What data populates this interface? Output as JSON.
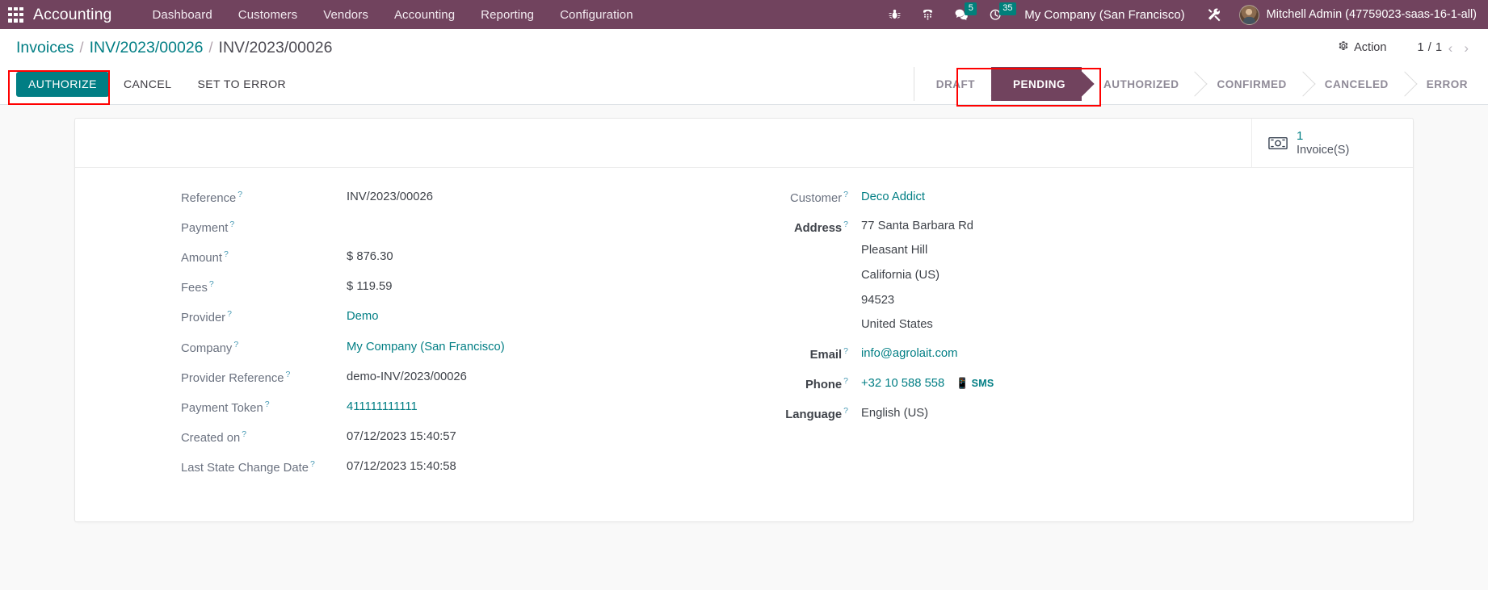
{
  "navbar": {
    "apps_icon": "apps-grid-icon",
    "brand": "Accounting",
    "menu": [
      {
        "label": "Dashboard"
      },
      {
        "label": "Customers"
      },
      {
        "label": "Vendors"
      },
      {
        "label": "Accounting"
      },
      {
        "label": "Reporting"
      },
      {
        "label": "Configuration"
      }
    ],
    "systray": [
      {
        "icon": "bug-icon",
        "badge": null
      },
      {
        "icon": "phone-dialpad-icon",
        "badge": null
      },
      {
        "icon": "messages-icon",
        "badge": "5"
      },
      {
        "icon": "clock-activities-icon",
        "badge": "35"
      }
    ],
    "company": "My Company (San Francisco)",
    "tools_icon": "wrench-screwdriver-icon",
    "avatar_icon": "user-avatar",
    "user": "Mitchell Admin (47759023-saas-16-1-all)"
  },
  "control_panel": {
    "breadcrumb": [
      {
        "label": "Invoices",
        "current": false
      },
      {
        "label": "INV/2023/00026",
        "current": false
      },
      {
        "label": "INV/2023/00026",
        "current": true
      }
    ],
    "separator": "/",
    "action_label": "Action",
    "action_icon": "gear-icon",
    "pager_value": "1 / 1",
    "pager_prev_icon": "chevron-left-icon",
    "pager_next_icon": "chevron-right-icon"
  },
  "statusbar": {
    "buttons": [
      {
        "label": "Authorize",
        "style": "primary",
        "highlighted": true
      },
      {
        "label": "Cancel",
        "style": "link",
        "highlighted": false
      },
      {
        "label": "Set to Error",
        "style": "link",
        "highlighted": false
      }
    ],
    "stages": [
      {
        "label": "Draft",
        "active": false
      },
      {
        "label": "Pending",
        "active": true
      },
      {
        "label": "Authorized",
        "active": false
      },
      {
        "label": "Confirmed",
        "active": false
      },
      {
        "label": "Canceled",
        "active": false
      },
      {
        "label": "Error",
        "active": false
      }
    ]
  },
  "sheet": {
    "stat_button": {
      "icon": "money-bill-icon",
      "value": "1",
      "label": "Invoice(S)"
    },
    "left_fields": [
      {
        "label": "Reference",
        "value": "INV/2023/00026",
        "link": false,
        "required": false
      },
      {
        "label": "Payment",
        "value": "",
        "link": false,
        "required": false
      },
      {
        "label": "Amount",
        "value": "$ 876.30",
        "link": false,
        "required": false
      },
      {
        "label": "Fees",
        "value": "$ 119.59",
        "link": false,
        "required": false
      },
      {
        "label": "Provider",
        "value": "Demo",
        "link": true,
        "required": false
      },
      {
        "label": "Company",
        "value": "My Company (San Francisco)",
        "link": true,
        "required": false
      },
      {
        "label": "Provider Reference",
        "value": "demo-INV/2023/00026",
        "link": false,
        "required": false
      },
      {
        "label": "Payment Token",
        "value": "411111111111",
        "link": true,
        "required": false
      },
      {
        "label": "Created on",
        "value": "07/12/2023 15:40:57",
        "link": false,
        "required": false
      },
      {
        "label": "Last State Change Date",
        "value": "07/12/2023 15:40:58",
        "link": false,
        "required": false
      }
    ],
    "right_fields": {
      "customer": {
        "label": "Customer",
        "value": "Deco Addict"
      },
      "address": {
        "label": "Address",
        "lines": [
          "77 Santa Barbara Rd",
          "Pleasant Hill",
          "California (US)",
          "94523",
          "United States"
        ]
      },
      "email": {
        "label": "Email",
        "value": "info@agrolait.com"
      },
      "phone": {
        "label": "Phone",
        "value": "+32 10 588 558",
        "sms_label": "SMS",
        "sms_icon": "mobile-phone-icon"
      },
      "language": {
        "label": "Language",
        "value": "English (US)"
      }
    }
  },
  "colors": {
    "navbar_bg": "#71435e",
    "accent_teal": "#017e84",
    "badge_bg": "#00807b",
    "highlight_red": "#ff0000",
    "sheet_bg": "#f9f9f9"
  }
}
